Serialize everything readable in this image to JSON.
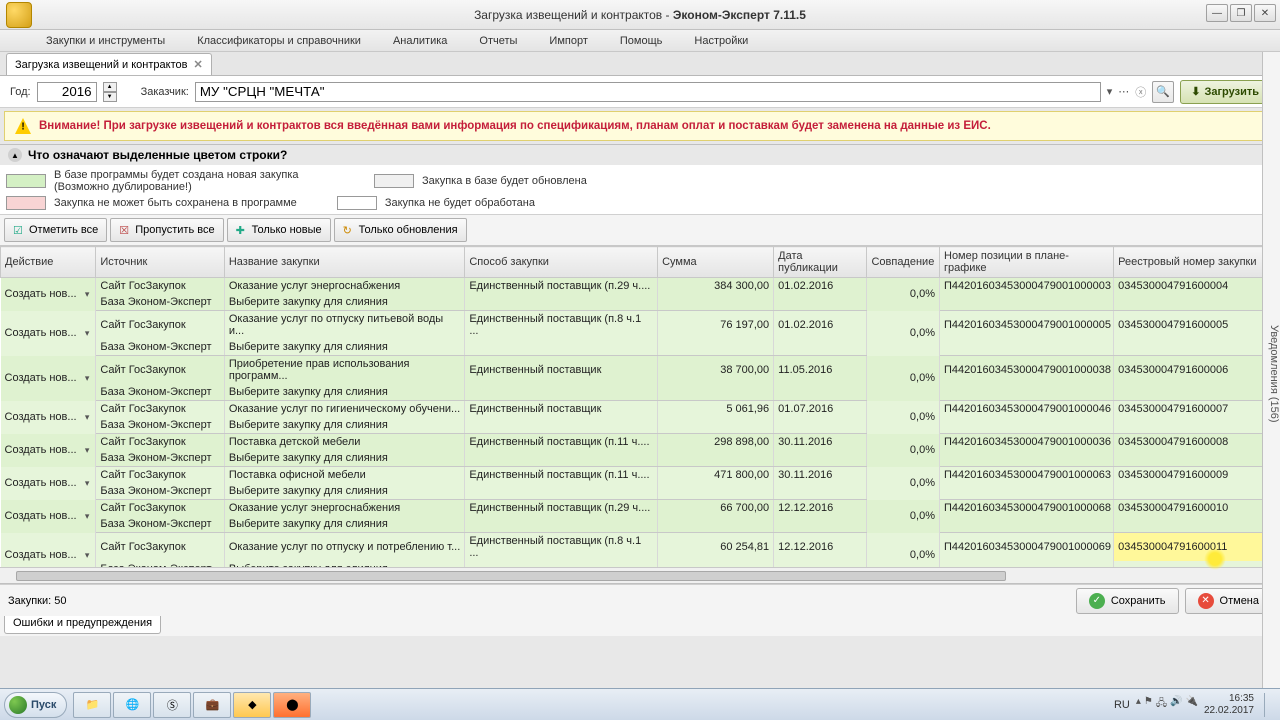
{
  "window": {
    "title_prefix": "Загрузка извещений и контрактов - ",
    "title_app": "Эконом-Эксперт 7.11.5"
  },
  "menu": [
    "Закупки и инструменты",
    "Классификаторы и справочники",
    "Аналитика",
    "Отчеты",
    "Импорт",
    "Помощь",
    "Настройки"
  ],
  "tab": {
    "label": "Загрузка извещений и контрактов"
  },
  "filter": {
    "year_label": "Год:",
    "year_value": "2016",
    "customer_label": "Заказчик:",
    "customer_value": "МУ \"СРЦН \"МЕЧТА\"",
    "load_btn": "Загрузить"
  },
  "warning": "Внимание! При загрузке извещений и контрактов вся введённая вами информация по спецификациям, планам оплат и поставкам будет заменена на данные из ЕИС.",
  "legend": {
    "title": "Что означают выделенные цветом строки?",
    "green": "В базе программы будет создана новая закупка (Возможно дублирование!)",
    "gray": "Закупка в базе будет обновлена",
    "pink": "Закупка не может быть сохранена в программе",
    "white": "Закупка не будет обработана"
  },
  "toolbar": {
    "mark_all": "Отметить все",
    "skip_all": "Пропустить все",
    "only_new": "Только новые",
    "only_upd": "Только обновления"
  },
  "columns": {
    "action": "Действие",
    "source": "Источник",
    "name": "Название закупки",
    "method": "Способ закупки",
    "sum": "Сумма",
    "date": "Дата публикации",
    "match": "Совпадение",
    "plan": "Номер позиции в плане-графике",
    "reg": "Реестровый номер закупки"
  },
  "common": {
    "action": "Создать нов...",
    "src1": "Сайт ГосЗакупок",
    "src2": "База Эконом-Эксперт",
    "sub": "Выберите закупку для слияния",
    "pct": "0,0%"
  },
  "rows": [
    {
      "name": "Оказание услуг энергоснабжения",
      "method": "Единственный поставщик (п.29 ч....",
      "sum": "384 300,00",
      "date": "01.02.2016",
      "plan": "П44201603453000479001000003",
      "reg": "034530004791600004"
    },
    {
      "name": "Оказание услуг по отпуску питьевой воды и...",
      "method": "Единственный поставщик (п.8 ч.1 ...",
      "sum": "76 197,00",
      "date": "01.02.2016",
      "plan": "П44201603453000479001000005",
      "reg": "034530004791600005"
    },
    {
      "name": "Приобретение прав использования программ...",
      "method": "Единственный поставщик",
      "sum": "38 700,00",
      "date": "11.05.2016",
      "plan": "П44201603453000479001000038",
      "reg": "034530004791600006"
    },
    {
      "name": "Оказание услуг по гигиеническому обучени...",
      "method": "Единственный поставщик",
      "sum": "5 061,96",
      "date": "01.07.2016",
      "plan": "П44201603453000479001000046",
      "reg": "034530004791600007"
    },
    {
      "name": "Поставка детской мебели",
      "method": "Единственный поставщик (п.11 ч....",
      "sum": "298 898,00",
      "date": "30.11.2016",
      "plan": "П44201603453000479001000036",
      "reg": "034530004791600008"
    },
    {
      "name": "Поставка офисной мебели",
      "method": "Единственный поставщик (п.11 ч....",
      "sum": "471 800,00",
      "date": "30.11.2016",
      "plan": "П44201603453000479001000063",
      "reg": "034530004791600009"
    },
    {
      "name": "Оказание услуг энергоснабжения",
      "method": "Единственный поставщик (п.29 ч....",
      "sum": "66 700,00",
      "date": "12.12.2016",
      "plan": "П44201603453000479001000068",
      "reg": "034530004791600010"
    },
    {
      "name": "Оказание услуг по отпуску и потреблению т...",
      "method": "Единственный поставщик (п.8 ч.1 ...",
      "sum": "60 254,81",
      "date": "12.12.2016",
      "plan": "П44201603453000479001000069",
      "reg": "034530004791600011"
    }
  ],
  "footer": {
    "count": "Закупки: 50",
    "save": "Сохранить",
    "cancel": "Отмена"
  },
  "bottom_tab": "Ошибки и предупреждения",
  "side": "Уведомления (156)",
  "taskbar": {
    "start": "Пуск",
    "lang": "RU",
    "time": "16:35",
    "date": "22.02.2017"
  }
}
